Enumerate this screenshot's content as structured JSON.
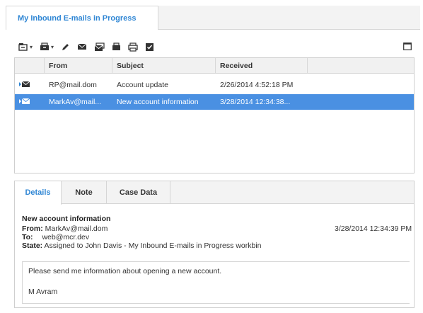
{
  "view": {
    "tab_title": "My Inbound E-mails in Progress"
  },
  "toolbar": {
    "buttons": [
      {
        "icon": "move-to-workbin-icon",
        "has_dropdown": true
      },
      {
        "icon": "workbin-icon",
        "has_dropdown": true
      },
      {
        "icon": "edit-pencil-icon",
        "has_dropdown": false
      },
      {
        "icon": "reply-email-icon",
        "has_dropdown": false
      },
      {
        "icon": "reply-all-email-icon",
        "has_dropdown": false
      },
      {
        "icon": "workbin-tray-icon",
        "has_dropdown": false
      },
      {
        "icon": "print-icon",
        "has_dropdown": false
      },
      {
        "icon": "mark-done-icon",
        "has_dropdown": false
      }
    ],
    "maximize_icon": "maximize-icon"
  },
  "grid": {
    "columns": [
      "",
      "From",
      "Subject",
      "Received"
    ],
    "rows": [
      {
        "from": "RP@mail.dom",
        "subject": "Account update",
        "received": "2/26/2014 4:52:18 PM",
        "selected": false
      },
      {
        "from": "MarkAv@mail...",
        "subject": "New account information",
        "received": "3/28/2014 12:34:38...",
        "selected": true
      }
    ]
  },
  "details": {
    "tabs": [
      "Details",
      "Note",
      "Case Data"
    ],
    "active_tab": "Details",
    "subject": "New account information",
    "from_label": "From:",
    "from_value": "MarkAv@mail.dom",
    "to_label": "To:",
    "to_value": "web@mcr.dev",
    "state_label": "State:",
    "state_value": "Assigned to John Davis - My Inbound E-mails in Progress workbin",
    "received": "3/28/2014 12:34:39 PM",
    "body_lines": [
      "Please send me information about opening a new account.",
      "M Avram"
    ]
  },
  "colors": {
    "accent": "#2f86d4",
    "selection": "#4a90e2"
  }
}
